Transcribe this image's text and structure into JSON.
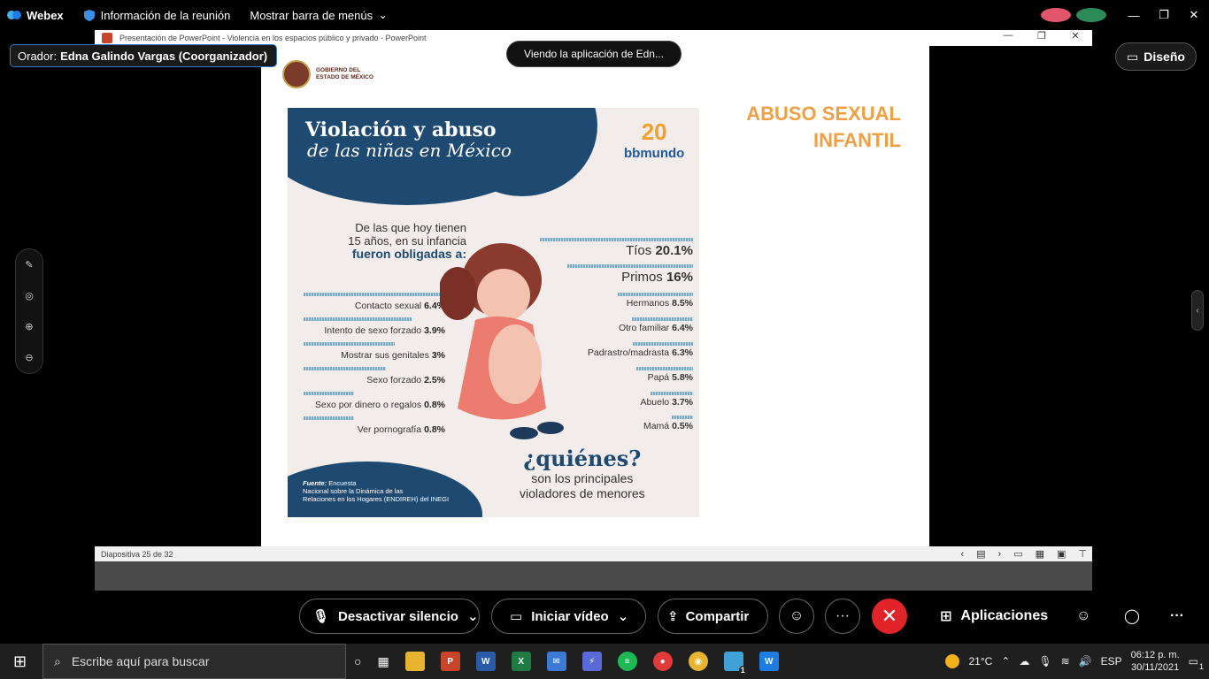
{
  "webex": {
    "app_name": "Webex",
    "meeting_info": "Información de la reunión",
    "menu_bar": "Mostrar barra de menús",
    "speaker_label": "Orador:",
    "speaker_name": "Edna Galindo Vargas (Coorganizador)",
    "viewing": "Viendo la aplicación de Edn...",
    "layout_button": "Diseño",
    "right_tab_glyph": "‹",
    "window_controls": {
      "minimize": "—",
      "restore": "❐",
      "close": "✕"
    }
  },
  "ppt": {
    "title": "Presentación de PowerPoint  -  Violencia en los espacios público y privado - PowerPoint",
    "window_controls": {
      "minimize": "—",
      "restore": "❐",
      "close": "✕"
    },
    "status": "Diapositiva 25 de 32",
    "stripe_colors": [
      "#7b3fa0",
      "#c0478a",
      "#d94a7e",
      "#2fa3d6",
      "#2fa36b",
      "#8dc63f",
      "#f2d21a",
      "#f39a1e",
      "#e23b3b",
      "#e23b3b",
      "#d94a7e"
    ]
  },
  "slide": {
    "gov_line1": "GOBIERNO DEL",
    "gov_line2": "ESTADO DE MÉXICO",
    "heading_line1": "ABUSO SEXUAL",
    "heading_line2": "INFANTIL",
    "infographic": {
      "title1": "Violación y abuso",
      "title2": "de las niñas en México",
      "brand_number": "20",
      "brand_name": "bbmundo",
      "intro1": "De las que hoy tienen",
      "intro2": "15 años, en su infancia",
      "intro3": "fueron obligadas a:",
      "left_items": [
        {
          "label": "Contacto sexual",
          "value": "6.4%",
          "pct": 6.4
        },
        {
          "label": "Intento de sexo forzado",
          "value": "3.9%",
          "pct": 3.9
        },
        {
          "label": "Mostrar sus genitales",
          "value": "3%",
          "pct": 3
        },
        {
          "label": "Sexo forzado",
          "value": "2.5%",
          "pct": 2.5
        },
        {
          "label": "Sexo por dinero o regalos",
          "value": "0.8%",
          "pct": 0.8
        },
        {
          "label": "Ver pornografía",
          "value": "0.8%",
          "pct": 0.8
        }
      ],
      "right_items": [
        {
          "label": "Tíos",
          "value": "20.1%",
          "pct": 20.1
        },
        {
          "label": "Primos",
          "value": "16%",
          "pct": 16
        },
        {
          "label": "Hermanos",
          "value": "8.5%",
          "pct": 8.5
        },
        {
          "label": "Otro familiar",
          "value": "6.4%",
          "pct": 6.4
        },
        {
          "label": "Padrastro/madrasta",
          "value": "6.3%",
          "pct": 6.3
        },
        {
          "label": "Papá",
          "value": "5.8%",
          "pct": 5.8
        },
        {
          "label": "Abuelo",
          "value": "3.7%",
          "pct": 3.7
        },
        {
          "label": "Mamá",
          "value": "0.5%",
          "pct": 0.5
        }
      ],
      "question": "¿quiénes?",
      "sub1": "son los principales",
      "sub2": "violadores de menores",
      "source_label": "Fuente:",
      "source1": "Encuesta",
      "source2": "Nacional sobre la Dinámica de las",
      "source3": "Relaciones en los Hogares (ENDIREH) del INEGI"
    }
  },
  "controls": {
    "mute": "Desactivar silencio",
    "video": "Iniciar vídeo",
    "share": "Compartir",
    "apps": "Aplicaciones",
    "more": "···",
    "end": "✕"
  },
  "taskbar": {
    "search_placeholder": "Escribe aquí para buscar",
    "weather": "21°C",
    "lang": "ESP",
    "time": "06:12 p. m.",
    "date": "30/11/2021",
    "notif_count": "1",
    "webex_badge": "1"
  }
}
